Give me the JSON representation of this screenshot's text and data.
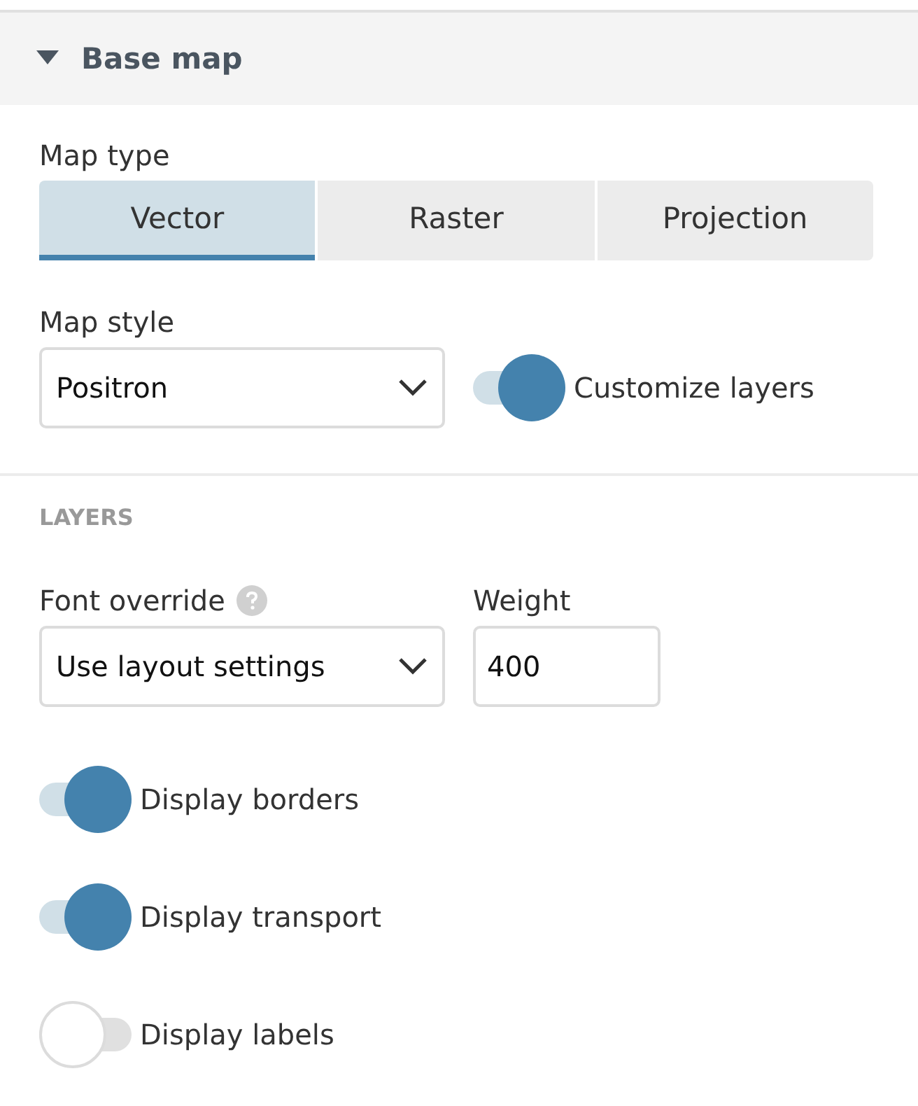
{
  "section": {
    "title": "Base map",
    "expanded": true
  },
  "map_type": {
    "label": "Map type",
    "options": [
      {
        "label": "Vector",
        "selected": true
      },
      {
        "label": "Raster",
        "selected": false
      },
      {
        "label": "Projection",
        "selected": false
      }
    ]
  },
  "map_style": {
    "label": "Map style",
    "value": "Positron"
  },
  "customize_layers": {
    "label": "Customize layers",
    "on": true
  },
  "layers": {
    "heading": "LAYERS",
    "font_override": {
      "label": "Font override",
      "value": "Use layout settings"
    },
    "weight": {
      "label": "Weight",
      "value": "400"
    },
    "toggles": [
      {
        "label": "Display borders",
        "on": true
      },
      {
        "label": "Display transport",
        "on": true
      },
      {
        "label": "Display labels",
        "on": false
      }
    ]
  }
}
